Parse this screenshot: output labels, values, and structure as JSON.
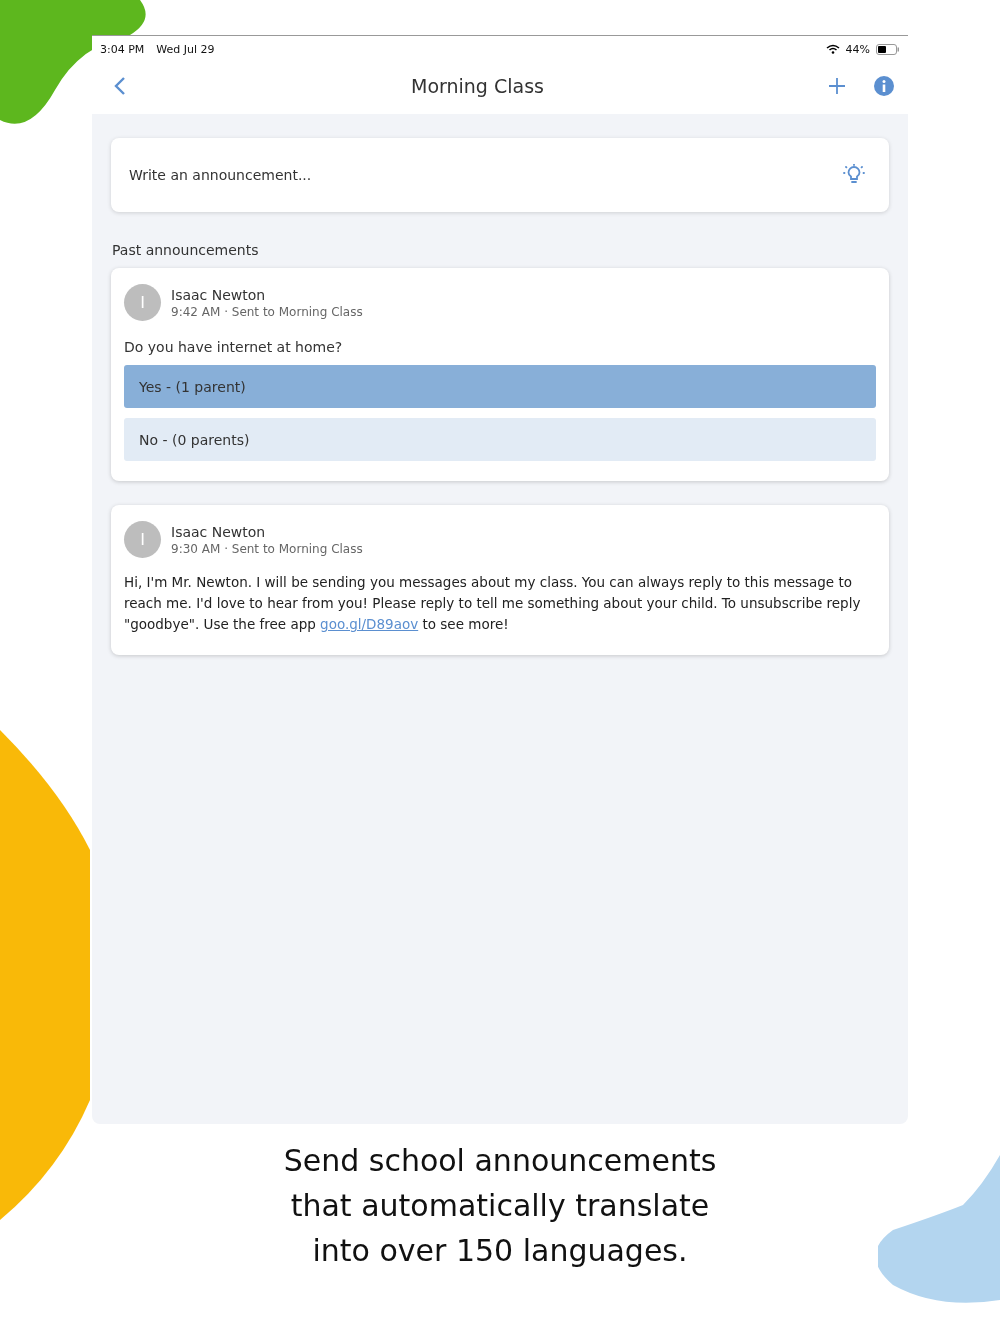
{
  "status_bar": {
    "time": "3:04 PM",
    "date": "Wed Jul 29",
    "battery": "44%"
  },
  "nav_bar": {
    "title": "Morning Class"
  },
  "composer": {
    "placeholder": "Write an announcement..."
  },
  "section_title": "Past announcements",
  "announcements": [
    {
      "kind": "poll",
      "avatar_letter": "I",
      "author": "Isaac Newton",
      "meta": "9:42 AM · Sent to Morning Class",
      "question": "Do you have internet at home?",
      "options": [
        {
          "label": "Yes - (1 parent)",
          "selected": true
        },
        {
          "label": "No - (0 parents)",
          "selected": false
        }
      ]
    },
    {
      "kind": "message",
      "avatar_letter": "I",
      "author": "Isaac Newton",
      "meta": "9:30 AM · Sent to Morning Class",
      "text_before": "Hi, I'm Mr. Newton. I will be sending you messages about my class. You can always reply to this message to reach me. I'd love to hear from you! Please reply to tell me something about your child. To unsubscribe reply \"goodbye\". Use the free app",
      "link": "goo.gl/D89aov",
      "text_after": "to see more!"
    }
  ],
  "caption": "Send school announcements that automatically translate into over 150 languages."
}
